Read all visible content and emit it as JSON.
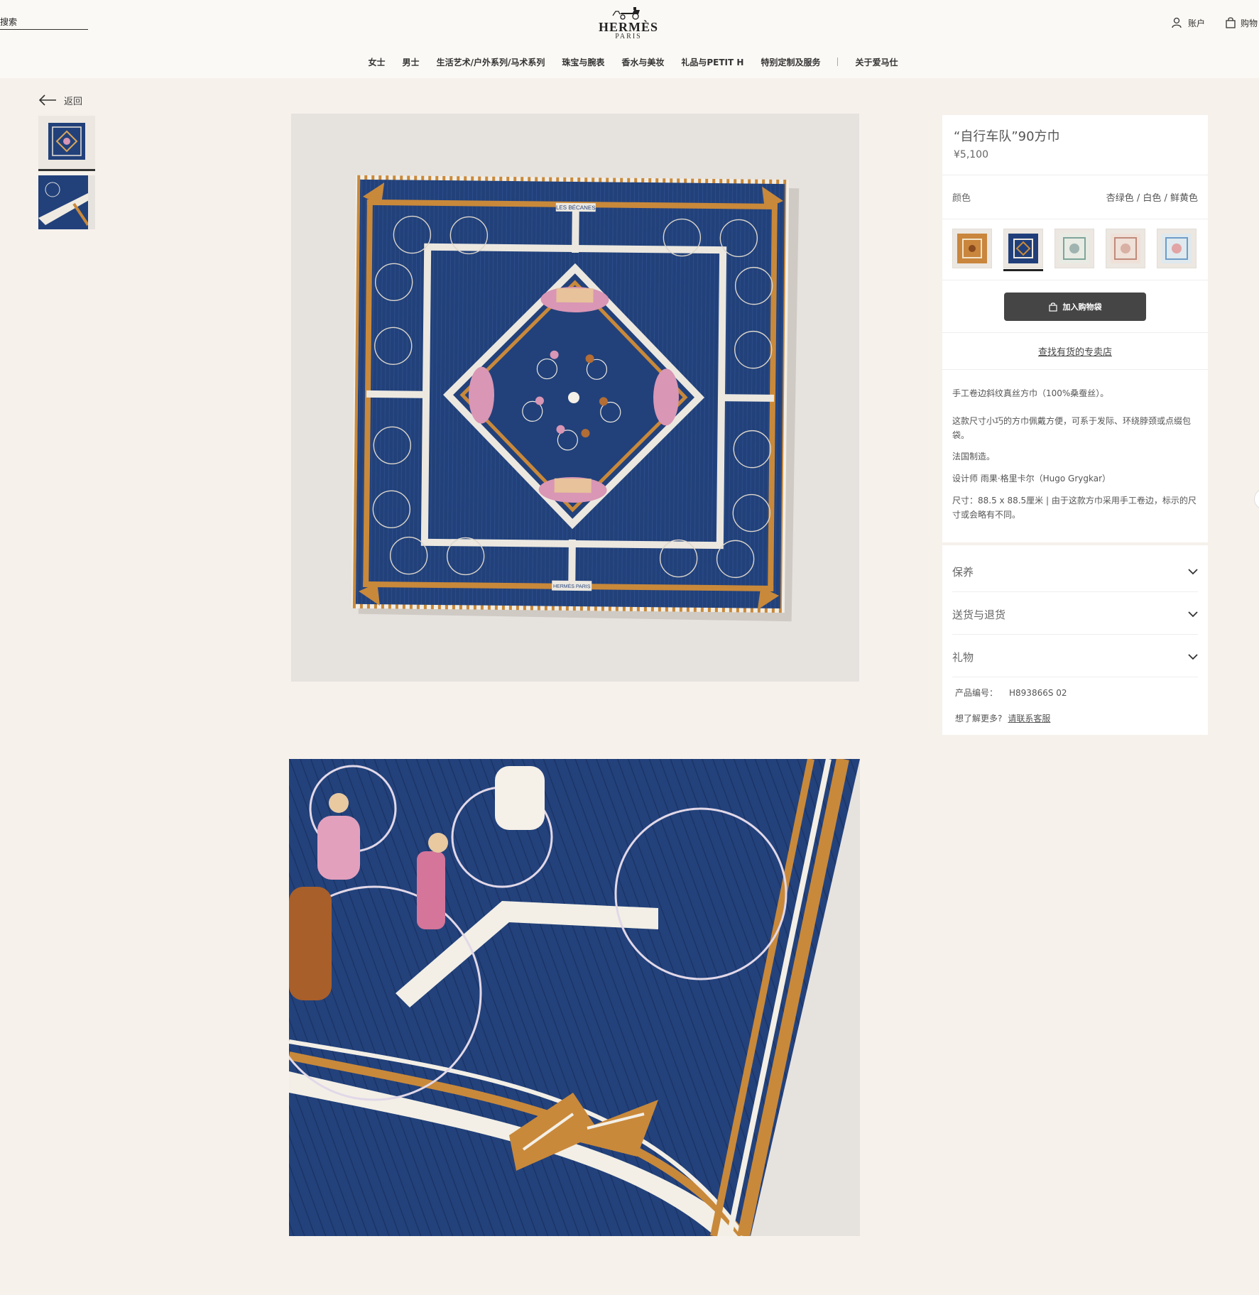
{
  "header": {
    "search_label": "搜索",
    "brand": "HERMÈS",
    "brand_sub": "PARIS",
    "account_label": "账户",
    "bag_label": "购物"
  },
  "nav": {
    "items": [
      "女士",
      "男士",
      "生活艺术/户外系列/马术系列",
      "珠宝与腕表",
      "香水与美妆",
      "礼品与PETIT H",
      "特别定制及服务"
    ],
    "about": "关于爱马仕"
  },
  "back_label": "返回",
  "product": {
    "title": "“自行车队”90方巾",
    "price": "¥5,100",
    "color_label": "颜色",
    "color_value": "杏绿色 / 白色 / 鲜黄色",
    "swatch_colors": [
      "#c9863c",
      "#203f7a",
      "#9fb4b0",
      "#d9b0a4",
      "#6e9cc8"
    ],
    "selected_swatch": 1,
    "add_to_bag": "加入购物袋",
    "store_link": "查找有货的专卖店",
    "description": [
      "手工卷边斜纹真丝方巾（100%桑蚕丝）。",
      "这款尺寸小巧的方巾佩戴方便，可系于发际、环绕脖颈或点缀包袋。",
      "法国制造。",
      "设计师 雨果·格里卡尔（Hugo Grygkar）",
      "尺寸：88.5 x 88.5厘米 | 由于这款方巾采用手工卷边，标示的尺寸或会略有不同。"
    ],
    "accordion": [
      "保养",
      "送货与退货",
      "礼物"
    ],
    "code_label": "产品编号：",
    "code_value": "H893866S 02",
    "help_label": "想了解更多?",
    "help_link": "请联系客服"
  },
  "scarf_text": {
    "top": "LES BÉCANES",
    "bottom": "HERMÈS PARIS"
  },
  "colors": {
    "background": "#f6f1eb",
    "scarf_navy": "#22417a",
    "scarf_gold": "#c9893a",
    "button": "#454545"
  }
}
